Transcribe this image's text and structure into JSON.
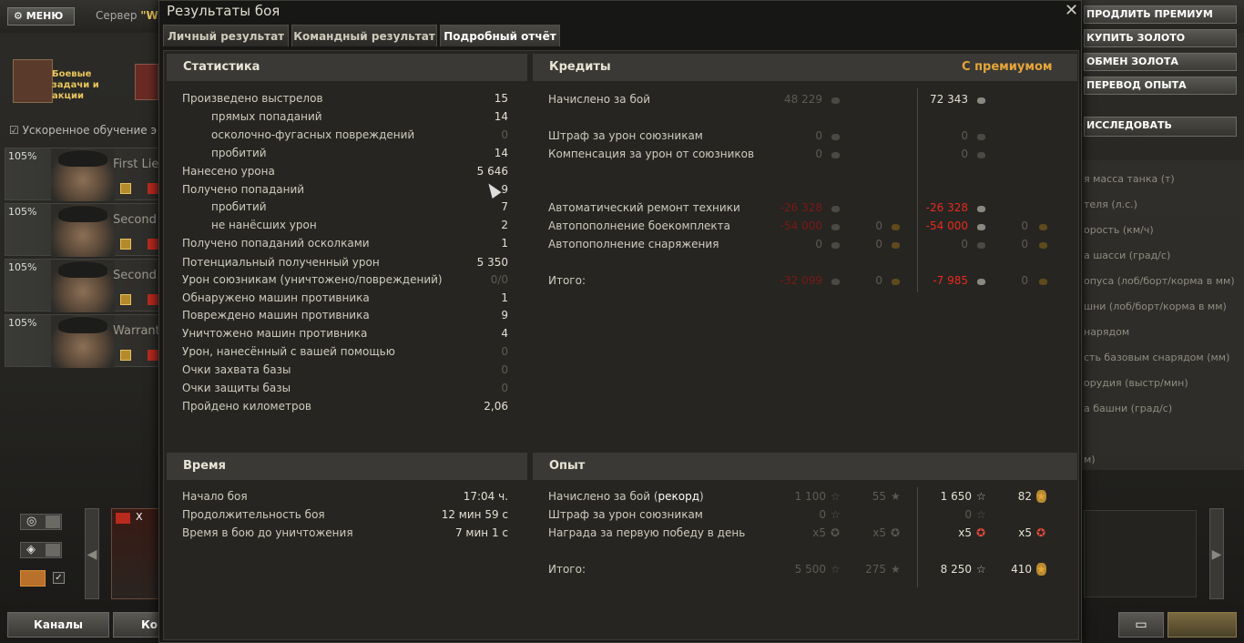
{
  "app": {
    "menu_label": "МЕНЮ",
    "server_prefix": "Сервер ",
    "server_name": "\"W.o",
    "quests_label": "Боевые задачи и акции",
    "accelerated_training": "Ускоренное обучение э",
    "crew": [
      {
        "percent": "105%",
        "rank": "First Lieu"
      },
      {
        "percent": "105%",
        "rank": "Second L"
      },
      {
        "percent": "105%",
        "rank": "Second L"
      },
      {
        "percent": "105%",
        "rank": "Warrant"
      }
    ],
    "tank_tier": "X",
    "channels_label": "Каналы",
    "contacts_label": "Кон",
    "right_buttons": [
      "ПРОДЛИТЬ ПРЕМИУМ",
      "КУПИТЬ ЗОЛОТО",
      "ОБМЕН ЗОЛОТА",
      "ПЕРЕВОД ОПЫТА"
    ],
    "research_label": "ИССЛЕДОВАТЬ",
    "right_stats": [
      "я масса танка (т)",
      "теля (л.с.)",
      "орость (км/ч)",
      "а шасси (град/с)",
      "опуса (лоб/борт/корма в мм)",
      "шни (лоб/борт/корма в мм)",
      "нарядом",
      "сть базовым снарядом (мм)",
      "орудия (выстр/мин)",
      "а башни (град/с)",
      "м)"
    ]
  },
  "dialog": {
    "title": "Результаты боя",
    "tabs": [
      "Личный результат",
      "Командный результат",
      "Подробный отчёт"
    ],
    "active_tab": 2,
    "stats": {
      "header": "Статистика",
      "rows": [
        {
          "label": "Произведено выстрелов",
          "value": "15",
          "indent": false,
          "dim": false
        },
        {
          "label": "прямых попаданий",
          "value": "14",
          "indent": true,
          "dim": false
        },
        {
          "label": "осколочно-фугасных повреждений",
          "value": "0",
          "indent": true,
          "dim": true
        },
        {
          "label": "пробитий",
          "value": "14",
          "indent": true,
          "dim": false
        },
        {
          "label": "Нанесено урона",
          "value": "5 646",
          "indent": false,
          "dim": false
        },
        {
          "label": "Получено попаданий",
          "value": "9",
          "indent": false,
          "dim": false
        },
        {
          "label": "пробитий",
          "value": "7",
          "indent": true,
          "dim": false
        },
        {
          "label": "не нанёсших урон",
          "value": "2",
          "indent": true,
          "dim": false
        },
        {
          "label": "Получено попаданий осколками",
          "value": "1",
          "indent": false,
          "dim": false
        },
        {
          "label": "Потенциальный полученный урон",
          "value": "5 350",
          "indent": false,
          "dim": false
        },
        {
          "label": "Урон союзникам (уничтожено/повреждений)",
          "value": "0/0",
          "indent": false,
          "dim": true
        },
        {
          "label": "Обнаружено машин противника",
          "value": "1",
          "indent": false,
          "dim": false
        },
        {
          "label": "Повреждено машин противника",
          "value": "9",
          "indent": false,
          "dim": false
        },
        {
          "label": "Уничтожено машин противника",
          "value": "4",
          "indent": false,
          "dim": false
        },
        {
          "label": "Урон, нанесённый с вашей помощью",
          "value": "0",
          "indent": false,
          "dim": true
        },
        {
          "label": "Очки захвата базы",
          "value": "0",
          "indent": false,
          "dim": true
        },
        {
          "label": "Очки защиты базы",
          "value": "0",
          "indent": false,
          "dim": true
        },
        {
          "label": "Пройдено километров",
          "value": "2,06",
          "indent": false,
          "dim": false
        }
      ]
    },
    "credits": {
      "header": "Кредиты",
      "premium_header": "С премиумом",
      "rows": [
        {
          "label": "Начислено за бой",
          "c1": "48 229",
          "g1": "",
          "c2": "72 343",
          "g2": "",
          "c1_style": "dim",
          "c2_style": "norm"
        },
        {
          "label": "Штраф за урон союзникам",
          "c1": "0",
          "g1": "",
          "c2": "0",
          "g2": "",
          "c1_style": "dim",
          "c2_style": "dim"
        },
        {
          "label": "Компенсация за урон от союзников",
          "c1": "0",
          "g1": "",
          "c2": "0",
          "g2": "",
          "c1_style": "dim",
          "c2_style": "dim"
        },
        {
          "label": "Автоматический ремонт техники",
          "c1": "-26 328",
          "g1": "",
          "c2": "-26 328",
          "g2": "",
          "c1_style": "dred",
          "c2_style": "red"
        },
        {
          "label": "Автопополнение боекомплекта",
          "c1": "-54 000",
          "g1": "0",
          "c2": "-54 000",
          "g2": "0",
          "c1_style": "dred",
          "c2_style": "red"
        },
        {
          "label": "Автопополнение снаряжения",
          "c1": "0",
          "g1": "0",
          "c2": "0",
          "g2": "0",
          "c1_style": "dim",
          "c2_style": "dim"
        },
        {
          "label": "Итого:",
          "c1": "-32 099",
          "g1": "0",
          "c2": "-7 985",
          "g2": "0",
          "c1_style": "dred",
          "c2_style": "red"
        }
      ]
    },
    "time": {
      "header": "Время",
      "rows": [
        {
          "label": "Начало боя",
          "value": "17:04 ч."
        },
        {
          "label": "Продолжительность боя",
          "value": "12 мин 59 с"
        },
        {
          "label": "Время в бою до уничтожения",
          "value": "7 мин 1 с"
        }
      ]
    },
    "experience": {
      "header": "Опыт",
      "record_prefix": "Начислено за бой (",
      "record_word": "рекорд",
      "record_suffix": ")",
      "rows": [
        {
          "label": "",
          "x1": "1 100",
          "f1": "55",
          "x2": "1 650",
          "f2": "82",
          "x2_style": "norm"
        },
        {
          "label": "Штраф за урон союзникам",
          "x1": "0",
          "f1": "",
          "x2": "0",
          "f2": "",
          "x2_style": "dim"
        },
        {
          "label": "Награда за первую победу в день",
          "x1": "x5",
          "f1": "x5",
          "x2": "x5",
          "f2": "x5",
          "x2_style": "norm"
        },
        {
          "label": "Итого:",
          "x1": "5 500",
          "f1": "275",
          "x2": "8 250",
          "f2": "410",
          "x2_style": "norm"
        }
      ]
    }
  },
  "colors": {
    "premium": "#e4a53a",
    "negative": "#e82a1e",
    "accent_gold": "#e8c45c"
  }
}
